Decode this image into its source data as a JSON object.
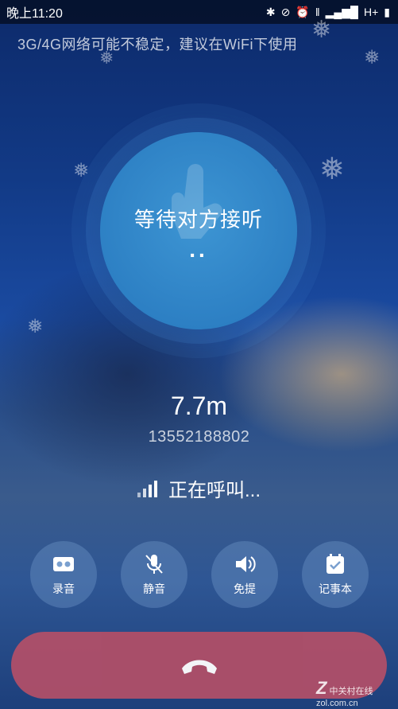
{
  "status_bar": {
    "time": "晚上11:20",
    "network": "H+"
  },
  "notice": "3G/4G网络可能不稳定，建议在WiFi下使用",
  "call": {
    "waiting_text": "等待对方接听",
    "dots": "..",
    "distance": "7.7m",
    "phone_number": "13552188802",
    "status": "正在呼叫..."
  },
  "actions": [
    {
      "label": "录音",
      "icon": "record-icon"
    },
    {
      "label": "静音",
      "icon": "mute-icon"
    },
    {
      "label": "免提",
      "icon": "speaker-icon"
    },
    {
      "label": "记事本",
      "icon": "notepad-icon"
    }
  ],
  "hangup": {
    "icon": "hangup-phone-icon"
  },
  "watermark": "中关村在线 zol.com.cn",
  "colors": {
    "hangup_bg": "#b04f68",
    "circle_bg": "#2d80c4"
  }
}
